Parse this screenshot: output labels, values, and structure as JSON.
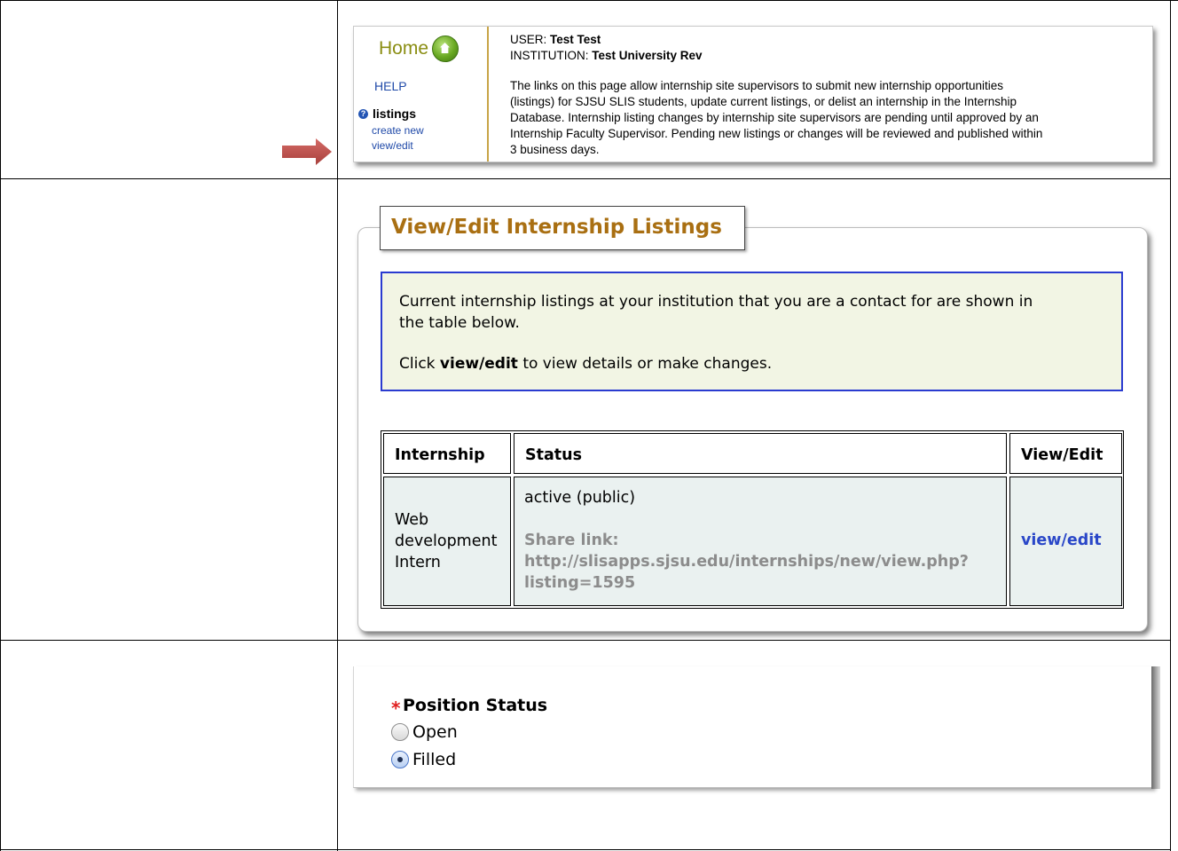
{
  "header": {
    "nav": {
      "home_label": "Home",
      "help_label": "HELP",
      "listings_label": "listings",
      "create_new_label": "create new",
      "view_edit_label": "view/edit"
    },
    "user_label": "USER:",
    "user_value": "Test Test",
    "institution_label": "INSTITUTION:",
    "institution_value": "Test University Rev",
    "description_lines": [
      "The links on this page allow internship site supervisors to submit new internship opportunities",
      "(listings) for SJSU SLIS students, update current listings, or delist an internship in the Internship",
      "Database. Internship listing changes by internship site supervisors are pending until approved by an",
      "Internship Faculty Supervisor. Pending new listings or changes will be reviewed and published within",
      "3 business days."
    ]
  },
  "listings_panel": {
    "title": "View/Edit Internship Listings",
    "info_line1": "Current internship listings at your institution that you are a contact for are shown in",
    "info_line2": "the table below.",
    "info_click_prefix": "Click ",
    "info_click_bold": "view/edit",
    "info_click_suffix": " to view details or make changes.",
    "table": {
      "headers": [
        "Internship",
        "Status",
        "View/Edit"
      ],
      "rows": [
        {
          "internship_lines": [
            "Web",
            "development",
            "Intern"
          ],
          "status": "active (public)",
          "share_label": "Share link:",
          "share_url_lines": [
            "http://slisapps.sjsu.edu/internships/new/view.php?",
            "listing=1595"
          ],
          "action": "view/edit"
        }
      ]
    }
  },
  "position_status": {
    "required_mark": "*",
    "title": "Position Status",
    "options": [
      {
        "label": "Open",
        "selected": false
      },
      {
        "label": "Filled",
        "selected": true
      }
    ]
  },
  "colors": {
    "arrow": "#c0504d",
    "legend_title": "#a96f12",
    "link": "#2a47c8",
    "info_border": "#2a3bd0",
    "info_bg": "#f2f5e4",
    "table_cell_bg": "#eaf1f0",
    "required": "#e02020"
  }
}
